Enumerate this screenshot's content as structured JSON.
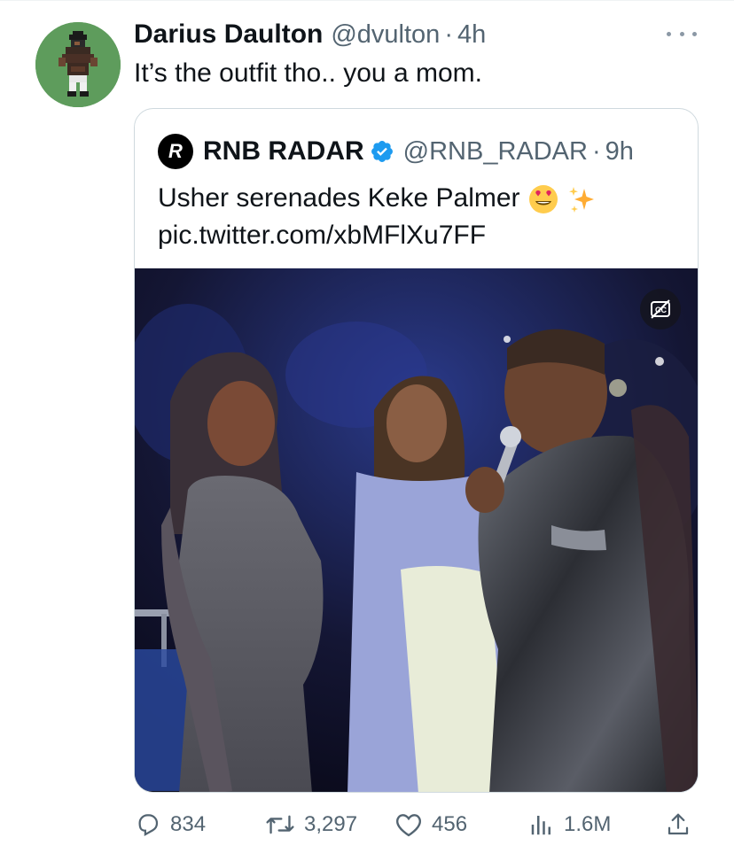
{
  "tweet": {
    "author_name": "Darius Daulton",
    "author_handle": "@dvulton",
    "separator": "·",
    "time": "4h",
    "text": "It’s the outfit tho.. you a mom.",
    "avatar_icon": "pixel-football-player-avatar",
    "more_icon": "more-horizontal-icon"
  },
  "quote": {
    "author_name": "RNB RADAR",
    "verified_icon": "verified-badge-icon",
    "author_handle": "@RNB_RADAR",
    "separator": "·",
    "time": "9h",
    "text_line1": "Usher serenades Keke Palmer",
    "text_line2": "pic.twitter.com/xbMFlXu7FF",
    "avatar_letter": "R",
    "emojis": [
      "smiling-face-with-heart-eyes",
      "sparkles"
    ],
    "media": {
      "type": "video",
      "captions_icon": "closed-captions-off-icon"
    }
  },
  "actions": {
    "replies": "834",
    "retweets": "3,297",
    "likes": "456",
    "views": "1.6M"
  },
  "colors": {
    "text_primary": "#0f1419",
    "text_secondary": "#536471",
    "border": "#cfd9de",
    "verified_blue": "#1d9bf0"
  }
}
